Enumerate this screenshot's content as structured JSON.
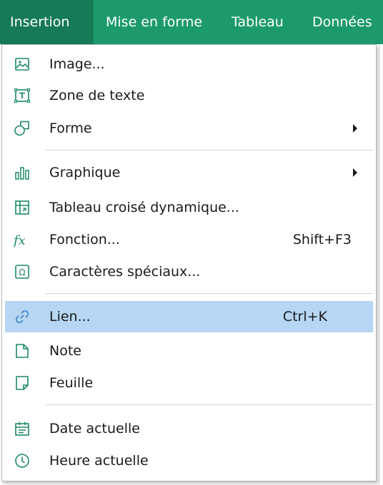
{
  "menubar": {
    "items": [
      {
        "label": "Insertion",
        "active": true
      },
      {
        "label": "Mise en forme"
      },
      {
        "label": "Tableau"
      },
      {
        "label": "Données"
      }
    ]
  },
  "menu": {
    "items": [
      {
        "label": "Image...",
        "icon": "image-icon"
      },
      {
        "label": "Zone de texte",
        "icon": "text-box-icon"
      },
      {
        "label": "Forme",
        "icon": "shape-icon",
        "submenu": true
      },
      {
        "label": "Graphique",
        "icon": "chart-icon",
        "submenu": true
      },
      {
        "label": "Tableau croisé dynamique...",
        "icon": "pivot-table-icon"
      },
      {
        "label": "Fonction...",
        "icon": "function-icon",
        "shortcut": "Shift+F3"
      },
      {
        "label": "Caractères spéciaux...",
        "icon": "omega-icon"
      },
      {
        "label": "Lien...",
        "icon": "link-icon",
        "shortcut": "Ctrl+K",
        "highlighted": true
      },
      {
        "label": "Note",
        "icon": "note-icon"
      },
      {
        "label": "Feuille",
        "icon": "sheet-icon"
      },
      {
        "label": "Date actuelle",
        "icon": "calendar-icon"
      },
      {
        "label": "Heure actuelle",
        "icon": "clock-icon"
      }
    ]
  },
  "colors": {
    "accent": "#1d9a6c",
    "accent_active": "#177a56",
    "highlight": "#b6d6f3",
    "icon_teal": "#1d8a63",
    "icon_blue": "#3a7ec8"
  }
}
